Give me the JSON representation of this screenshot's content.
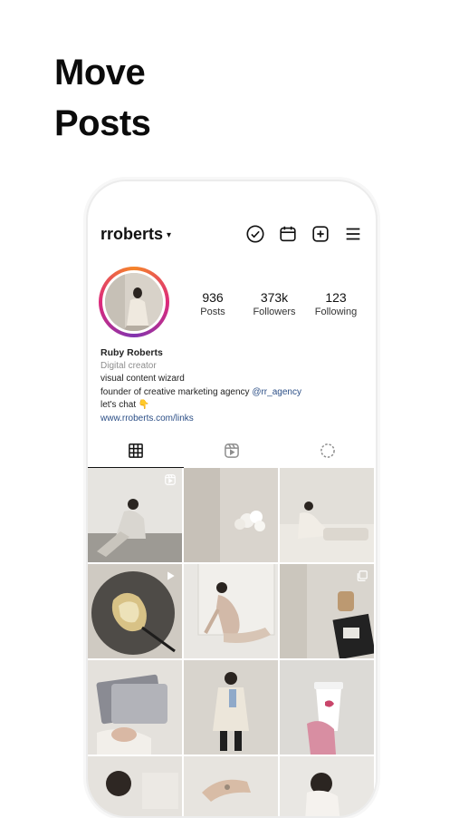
{
  "headline": {
    "line1": "Move",
    "line2": "Posts"
  },
  "profile": {
    "username": "rroberts",
    "stats": [
      {
        "value": "936",
        "label": "Posts"
      },
      {
        "value": "373k",
        "label": "Followers"
      },
      {
        "value": "123",
        "label": "Following"
      }
    ],
    "name": "Ruby Roberts",
    "category": "Digital creator",
    "bio_line1": "visual content wizard",
    "bio_line2_prefix": "founder of creative marketing agency ",
    "bio_line2_handle": "@rr_agency",
    "bio_line3": "let's chat 👇",
    "link": "www.rroberts.com/links"
  },
  "icons": {
    "top": [
      "check-circle-icon",
      "calendar-icon",
      "add-post-icon",
      "menu-icon"
    ],
    "tabs": [
      "grid-icon",
      "reels-icon",
      "drafts-icon"
    ]
  },
  "colors": {
    "ring_start": "#f58529",
    "ring_mid": "#dd2a7b",
    "link": "#2b4e86"
  }
}
